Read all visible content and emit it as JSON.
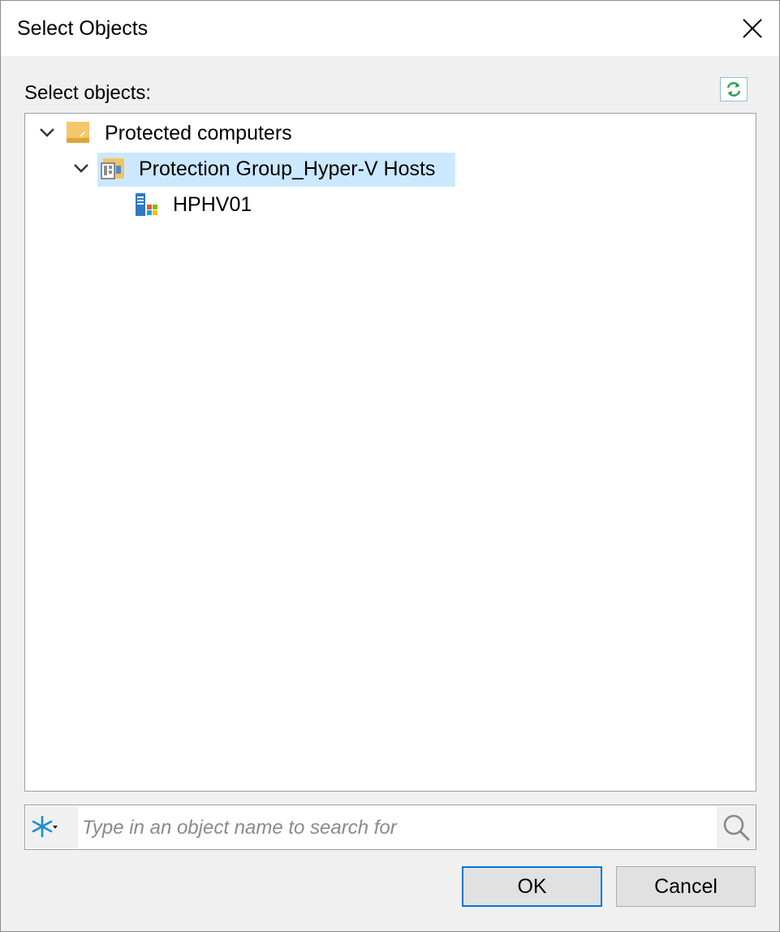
{
  "window": {
    "title": "Select Objects",
    "close_icon": "close-icon"
  },
  "label": "Select objects:",
  "refresh_icon": "refresh-icon",
  "tree": [
    {
      "label": "Protected computers",
      "icon": "folder-icon",
      "expanded": true,
      "selected": false
    },
    {
      "label": "Protection Group_Hyper-V Hosts",
      "icon": "protection-group-icon",
      "expanded": true,
      "selected": true
    },
    {
      "label": "HPHV01",
      "icon": "windows-server-icon",
      "expanded": false,
      "selected": false
    }
  ],
  "search": {
    "placeholder": "Type in an object name to search for",
    "value": "",
    "filter_icon": "asterisk-icon",
    "search_icon": "search-icon"
  },
  "buttons": {
    "ok": "OK",
    "cancel": "Cancel"
  },
  "colors": {
    "selection": "#cce8ff",
    "accent": "#0078d7",
    "folder": "#f0b54a"
  }
}
